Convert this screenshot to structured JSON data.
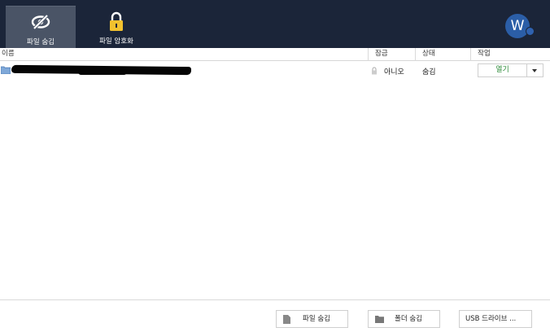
{
  "toolbar": {
    "hide_file_label": "파일 숨김",
    "encrypt_file_label": "파일 암호화"
  },
  "account": {
    "avatar_letter": "W",
    "avatar_color": "#2b5ea7"
  },
  "table": {
    "columns": {
      "name": "이름",
      "lock": "잠금",
      "status": "상태",
      "action": "작업"
    },
    "rows": [
      {
        "icon": "folder-icon",
        "lock": "아니오",
        "status": "숨김",
        "action": "열기"
      }
    ]
  },
  "footer": {
    "hide_file_button": "파일 숨김",
    "hide_folder_button": "폴더 숨김",
    "usb_button": "USB 드라이브 ..."
  },
  "colors": {
    "topbar": "#1b2539",
    "active_tool": "#4a5466",
    "open_text": "#2e8b3a"
  }
}
